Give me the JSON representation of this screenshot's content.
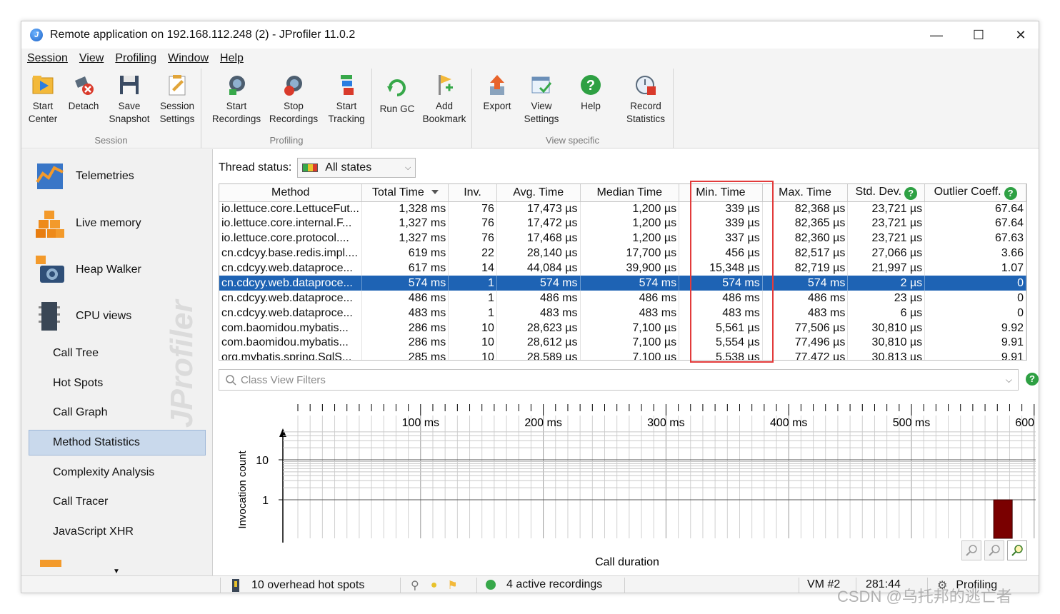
{
  "window": {
    "title": "Remote application on 192.168.112.248 (2) - JProfiler 11.0.2",
    "minimize": "—",
    "maximize": "☐",
    "close": "✕"
  },
  "menu": [
    "Session",
    "View",
    "Profiling",
    "Window",
    "Help"
  ],
  "toolbar": {
    "groups": [
      {
        "label": "Session",
        "buttons": [
          {
            "line1": "Start",
            "line2": "Center",
            "icon": "start-center-icon"
          },
          {
            "line1": "Detach",
            "line2": "",
            "icon": "detach-icon"
          },
          {
            "line1": "Save",
            "line2": "Snapshot",
            "icon": "save-snapshot-icon"
          },
          {
            "line1": "Session",
            "line2": "Settings",
            "icon": "session-settings-icon"
          }
        ]
      },
      {
        "label": "Profiling",
        "buttons": [
          {
            "line1": "Start",
            "line2": "Recordings",
            "icon": "start-recordings-icon"
          },
          {
            "line1": "Stop",
            "line2": "Recordings",
            "icon": "stop-recordings-icon"
          },
          {
            "line1": "Start",
            "line2": "Tracking",
            "icon": "start-tracking-icon"
          }
        ]
      },
      {
        "label": "",
        "buttons": [
          {
            "line1": "Run GC",
            "line2": "",
            "icon": "run-gc-icon"
          },
          {
            "line1": "Add",
            "line2": "Bookmark",
            "icon": "add-bookmark-icon"
          }
        ]
      },
      {
        "label": "View specific",
        "buttons": [
          {
            "line1": "Export",
            "line2": "",
            "icon": "export-icon"
          },
          {
            "line1": "View",
            "line2": "Settings",
            "icon": "view-settings-icon"
          },
          {
            "line1": "Help",
            "line2": "",
            "icon": "help-icon"
          }
        ]
      },
      {
        "label": "",
        "buttons": [
          {
            "line1": "Record",
            "line2": "Statistics",
            "icon": "record-statistics-icon"
          }
        ]
      }
    ]
  },
  "sidebar": {
    "main": [
      {
        "label": "Telemetries",
        "icon": "telemetries-icon"
      },
      {
        "label": "Live memory",
        "icon": "live-memory-icon"
      },
      {
        "label": "Heap Walker",
        "icon": "heap-walker-icon"
      },
      {
        "label": "CPU views",
        "icon": "cpu-views-icon"
      }
    ],
    "sub": [
      "Call Tree",
      "Hot Spots",
      "Call Graph",
      "Method Statistics",
      "Complexity Analysis",
      "Call Tracer",
      "JavaScript XHR"
    ],
    "selected": "Method Statistics",
    "watermark": "JProfiler"
  },
  "thread_status": {
    "label": "Thread status:",
    "value": "All states"
  },
  "table": {
    "columns": [
      "Method",
      "Total Time",
      "Inv.",
      "Avg. Time",
      "Median Time",
      "Min. Time",
      "Max. Time",
      "Std. Dev.",
      "Outlier Coeff."
    ],
    "selected_row": 5,
    "rows": [
      [
        "io.lettuce.core.LettuceFut...",
        "1,328 ms",
        "76",
        "17,473 µs",
        "1,200 µs",
        "339 µs",
        "82,368 µs",
        "23,721 µs",
        "67.64"
      ],
      [
        "io.lettuce.core.internal.F...",
        "1,327 ms",
        "76",
        "17,472 µs",
        "1,200 µs",
        "339 µs",
        "82,365 µs",
        "23,721 µs",
        "67.64"
      ],
      [
        "io.lettuce.core.protocol....",
        "1,327 ms",
        "76",
        "17,468 µs",
        "1,200 µs",
        "337 µs",
        "82,360 µs",
        "23,721 µs",
        "67.63"
      ],
      [
        "cn.cdcyy.base.redis.impl....",
        "619 ms",
        "22",
        "28,140 µs",
        "17,700 µs",
        "456 µs",
        "82,517 µs",
        "27,066 µs",
        "3.66"
      ],
      [
        "cn.cdcyy.web.dataproce...",
        "617 ms",
        "14",
        "44,084 µs",
        "39,900 µs",
        "15,348 µs",
        "82,719 µs",
        "21,997 µs",
        "1.07"
      ],
      [
        "cn.cdcyy.web.dataproce...",
        "574 ms",
        "1",
        "574 ms",
        "574 ms",
        "574 ms",
        "574 ms",
        "2 µs",
        "0"
      ],
      [
        "cn.cdcyy.web.dataproce...",
        "486 ms",
        "1",
        "486 ms",
        "486 ms",
        "486 ms",
        "486 ms",
        "23 µs",
        "0"
      ],
      [
        "cn.cdcyy.web.dataproce...",
        "483 ms",
        "1",
        "483 ms",
        "483 ms",
        "483 ms",
        "483 ms",
        "6 µs",
        "0"
      ],
      [
        "com.baomidou.mybatis...",
        "286 ms",
        "10",
        "28,623 µs",
        "7,100 µs",
        "5,561 µs",
        "77,506 µs",
        "30,810 µs",
        "9.92"
      ],
      [
        "com.baomidou.mybatis...",
        "286 ms",
        "10",
        "28,612 µs",
        "7,100 µs",
        "5,554 µs",
        "77,496 µs",
        "30,810 µs",
        "9.91"
      ],
      [
        "org.mybatis.spring.SqlS...",
        "285 ms",
        "10",
        "28,589 µs",
        "7,100 µs",
        "5,538 µs",
        "77,472 µs",
        "30,813 µs",
        "9.91"
      ]
    ]
  },
  "filter": {
    "placeholder": "Class View Filters"
  },
  "chart_data": {
    "type": "bar",
    "xlabel": "Call duration",
    "ylabel": "Invocation count",
    "x_ticks": [
      "100 ms",
      "200 ms",
      "300 ms",
      "400 ms",
      "500 ms",
      "600"
    ],
    "y_ticks": [
      "10",
      "1"
    ],
    "y_scale": "log",
    "bars": [
      {
        "x_ms": 574,
        "count": 1,
        "color": "#7a0000"
      }
    ]
  },
  "statusbar": {
    "hotspots": "10 overhead hot spots",
    "recordings": "4 active recordings",
    "vm": "VM #2",
    "time": "281:44",
    "mode": "Profiling"
  },
  "watermark_text": "CSDN @乌托邦的逃亡者",
  "colors": {
    "selection": "#1e63b4",
    "highlight_box": "#e23b3b",
    "bar": "#7a0000",
    "help_green": "#2ea043"
  }
}
